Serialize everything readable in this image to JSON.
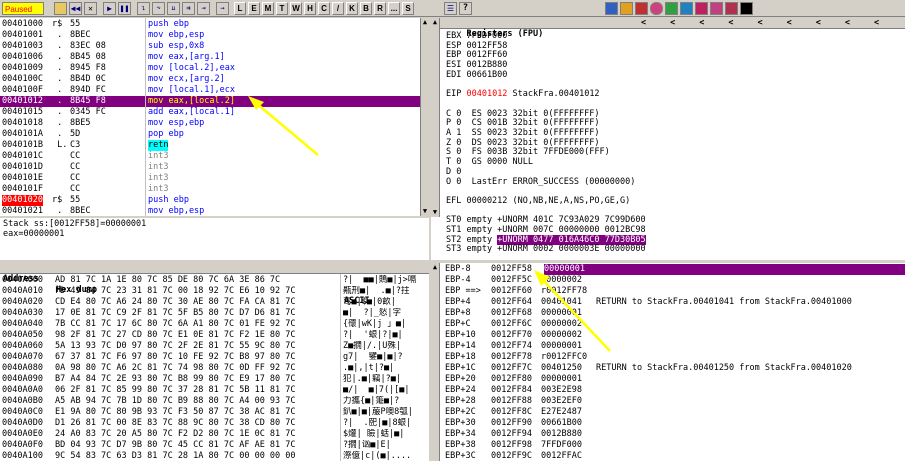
{
  "toolbar": {
    "status": "Paused",
    "letters": [
      "L",
      "E",
      "M",
      "T",
      "W",
      "H",
      "C",
      "/",
      "K",
      "B",
      "R",
      "...",
      "S"
    ],
    "help": "?"
  },
  "cpu": {
    "rows": [
      {
        "addr": "00401000",
        "mk": "r$",
        "hex": "55",
        "asm": "push ebp",
        "asmc": "blue"
      },
      {
        "addr": "00401001",
        "mk": " .",
        "hex": "8BEC",
        "asm": "mov ebp,esp",
        "asmc": "blue"
      },
      {
        "addr": "00401003",
        "mk": " .",
        "hex": "83EC 08",
        "asm": "sub esp,0x8",
        "asmc": "blue"
      },
      {
        "addr": "00401006",
        "mk": " .",
        "hex": "8B45 08",
        "asm": "mov eax,[arg.1]",
        "asmc": "blue"
      },
      {
        "addr": "00401009",
        "mk": " .",
        "hex": "8945 F8",
        "asm": "mov [local.2],eax",
        "asmc": "blue"
      },
      {
        "addr": "0040100C",
        "mk": " .",
        "hex": "8B4D 0C",
        "asm": "mov ecx,[arg.2]",
        "asmc": "blue"
      },
      {
        "addr": "0040100F",
        "mk": " .",
        "hex": "894D FC",
        "asm": "mov [local.1],ecx",
        "asmc": "blue"
      },
      {
        "addr": "00401012",
        "mk": " .",
        "hex": "8B45 F8",
        "asm": "mov eax,[local.2]",
        "asmc": "blue",
        "sel": true
      },
      {
        "addr": "00401015",
        "mk": " .",
        "hex": "0345 FC",
        "asm": "add eax,[local.1]",
        "asmc": "blue"
      },
      {
        "addr": "00401018",
        "mk": " .",
        "hex": "8BE5",
        "asm": "mov esp,ebp",
        "asmc": "blue"
      },
      {
        "addr": "0040101A",
        "mk": " .",
        "hex": "5D",
        "asm": "pop ebp",
        "asmc": "blue"
      },
      {
        "addr": "0040101B",
        "mk": " L.",
        "hex": "C3",
        "asm": "retn",
        "asmc": "retn"
      },
      {
        "addr": "0040101C",
        "mk": "",
        "hex": "CC",
        "asm": "int3",
        "asmc": "gray"
      },
      {
        "addr": "0040101D",
        "mk": "",
        "hex": "CC",
        "asm": "int3",
        "asmc": "gray"
      },
      {
        "addr": "0040101E",
        "mk": "",
        "hex": "CC",
        "asm": "int3",
        "asmc": "gray"
      },
      {
        "addr": "0040101F",
        "mk": "",
        "hex": "CC",
        "asm": "int3",
        "asmc": "gray"
      },
      {
        "addr": "00401020",
        "mk": "r$",
        "hex": "55",
        "asm": "push ebp",
        "asmc": "blue",
        "redaddr": true
      },
      {
        "addr": "00401021",
        "mk": " .",
        "hex": "8BEC",
        "asm": "mov ebp,esp",
        "asmc": "blue"
      }
    ],
    "info1": "Stack ss:[0012FF58]=00000001",
    "info2": "eax=00000001"
  },
  "registers": {
    "header": "Registers (FPU)",
    "arrows": [
      "<",
      "<",
      "<",
      "<",
      "<",
      "<",
      "<",
      "<",
      "<"
    ],
    "lines": [
      {
        "t": "EBX 7FFDF000"
      },
      {
        "t": "ESP 0012FF58"
      },
      {
        "t": "EBP 0012FF60"
      },
      {
        "t": "ESI 0012B880"
      },
      {
        "t": "EDI 00661B00"
      },
      {
        "t": ""
      },
      {
        "t": "EIP ",
        "red": "00401012",
        "rest": " StackFra.00401012"
      },
      {
        "t": ""
      },
      {
        "t": "C 0  ES 0023 32bit 0(FFFFFFFF)"
      },
      {
        "t": "P 0  CS 001B 32bit 0(FFFFFFFF)"
      },
      {
        "t": "A 1  SS 0023 32bit 0(FFFFFFFF)"
      },
      {
        "t": "Z 0  DS 0023 32bit 0(FFFFFFFF)"
      },
      {
        "t": "S 0  FS 003B 32bit 7FFDE000(FFF)"
      },
      {
        "t": "T 0  GS 0000 NULL"
      },
      {
        "t": "D 0"
      },
      {
        "t": "O 0  LastErr ERROR_SUCCESS (00000000)"
      },
      {
        "t": ""
      },
      {
        "t": "EFL 00000212 (NO,NB,NE,A,NS,PO,GE,G)"
      },
      {
        "t": ""
      },
      {
        "t": "ST0 empty +UNORM 401C 7C93A029 7C99D600"
      },
      {
        "t": "ST1 empty +UNORM 007C 00000000 0012BC98"
      },
      {
        "t": "ST2 empty ",
        "hl": "+UNORM 0477 016A46C0 77D30B05"
      },
      {
        "t": "ST3 empty +UNORM 0002 0000003E 00000000"
      }
    ]
  },
  "dump": {
    "col_address": "Address",
    "col_hex": "Hex dump",
    "col_ascii": "ASCII",
    "rows": [
      {
        "a": "0040A000",
        "h": "AD 81 7C 1A 1E 80 7C 85 DE 80 7C 6A 3E 86 7C",
        "s": "?|  ■■|鵙■|j>嗝"
      },
      {
        "a": "0040A010",
        "h": "FD 49 84 7C 23 31 81 7C 00 18 92 7C E6 10 92 7C",
        "s": "齀刑■|  .■|?拄"
      },
      {
        "a": "0040A020",
        "h": "CD E4 80 7C A6 24 80 7C 30 AE 80 7C FA CA 81 7C",
        "s": "弯■|$■|0畝|  "
      },
      {
        "a": "0040A030",
        "h": "17 0E 81 7C C9 2F 81 7C 5F B5 80 7C D7 D6 81 7C",
        "s": "■|  ?|_悐|字"
      },
      {
        "a": "0040A040",
        "h": "7B CC 81 7C 17 6C 80 7C 6A A1 80 7C 01 FE 92 7C",
        "s": "{蘹|wK|j 」■|"
      },
      {
        "a": "0040A050",
        "h": "98 2F 81 7C 27 CD 80 7C E1 0E 81 7C F2 1E 80 7C",
        "s": "?|  '蛝|?|■|"
      },
      {
        "a": "0040A060",
        "h": "5A 13 93 7C D0 97 80 7C 2F 2E 81 7C 55 9C 80 7C",
        "s": "Z■撊|/.|U殊|"
      },
      {
        "a": "0040A070",
        "h": "67 37 81 7C F6 97 80 7C 10 FE 92 7C B8 97 80 7C",
        "s": "g7|  鐾■|■|?"
      },
      {
        "a": "0040A080",
        "h": "0A 98 80 7C A6 2C 81 7C 74 98 80 7C 0D FF 92 7C",
        "s": ".■|,|t|?■|"
      },
      {
        "a": "0040A090",
        "h": "B7 A4 84 7C 2E 93 80 7C B8 99 80 7C E9 17 80 7C",
        "s": "犯|.■|竊|?■|"
      },
      {
        "a": "0040A0A0",
        "h": "06 2F 81 7C 85 99 80 7C 37 28 81 7C 5B 11 81 7C",
        "s": "■/|  ■|7(|[■|"
      },
      {
        "a": "0040A0B0",
        "h": "A5 AB 94 7C 7B 1D 80 7C B9 88 80 7C A4 00 93 7C",
        "s": "力攜{■|箑■|?"
      },
      {
        "a": "0040A0C0",
        "h": "E1 9A 80 7C 80 9B 93 7C F3 50 87 7C 38 AC 81 7C",
        "s": "釟■|■|菔P噢8瓠|"
      },
      {
        "a": "0040A0D0",
        "h": "D1 26 81 7C 00 8E 83 7C 88 9C 80 7C 38 CD 80 7C",
        "s": "?|  .巸|■|8蛝|"
      },
      {
        "a": "0040A0E0",
        "h": "24 A0 83 7C 20 A5 80 7C F2 D2 80 7C 1E 0C 81 7C",
        "s": "$爟| 瞼|蛞|■|"
      },
      {
        "a": "0040A0F0",
        "h": "BD 04 93 7C D7 9B 80 7C 45 CC 81 7C AF AE 81 7C",
        "s": "?撊|讻■|E|"
      },
      {
        "a": "0040A100",
        "h": "9C 54 83 7C 63 D3 81 7C 28 1A 80 7C 00 00 00 00",
        "s": "漈億|c|(■|...."
      }
    ]
  },
  "stack": {
    "rows": [
      {
        "a": "EBP-8",
        "v": "0012FF58",
        "d": "00000001",
        "c": "",
        "sel": true
      },
      {
        "a": "EBP-4",
        "v": "0012FF5C",
        "d": "00000002",
        "c": ""
      },
      {
        "a": "EBP ==>",
        "v": "0012FF60",
        "d": "r0012FF78",
        "c": ""
      },
      {
        "a": "EBP+4",
        "v": "0012FF64",
        "d": "00401041",
        "c": "RETURN to StackFra.00401041 from StackFra.00401000"
      },
      {
        "a": "EBP+8",
        "v": "0012FF68",
        "d": "00000001",
        "c": ""
      },
      {
        "a": "EBP+C",
        "v": "0012FF6C",
        "d": "00000002",
        "c": ""
      },
      {
        "a": "EBP+10",
        "v": "0012FF70",
        "d": "00000002",
        "c": ""
      },
      {
        "a": "EBP+14",
        "v": "0012FF74",
        "d": "00000001",
        "c": ""
      },
      {
        "a": "EBP+18",
        "v": "0012FF78",
        "d": "r0012FFC0",
        "c": ""
      },
      {
        "a": "EBP+1C",
        "v": "0012FF7C",
        "d": "00401250",
        "c": "RETURN to StackFra.00401250 from StackFra.00401020"
      },
      {
        "a": "EBP+20",
        "v": "0012FF80",
        "d": "00000001",
        "c": ""
      },
      {
        "a": "EBP+24",
        "v": "0012FF84",
        "d": "003E2E98",
        "c": ""
      },
      {
        "a": "EBP+28",
        "v": "0012FF88",
        "d": "003E2EF0",
        "c": ""
      },
      {
        "a": "EBP+2C",
        "v": "0012FF8C",
        "d": "E27E2487",
        "c": ""
      },
      {
        "a": "EBP+30",
        "v": "0012FF90",
        "d": "00661B00",
        "c": ""
      },
      {
        "a": "EBP+34",
        "v": "0012FF94",
        "d": "0012B880",
        "c": ""
      },
      {
        "a": "EBP+38",
        "v": "0012FF98",
        "d": "7FFDF000",
        "c": ""
      },
      {
        "a": "EBP+3C",
        "v": "0012FF9C",
        "d": "0012FFAC",
        "c": ""
      }
    ]
  },
  "colors": {
    "selection": "#800080",
    "arrow": "#ffff00",
    "toolbar": "#d4d0c8"
  }
}
